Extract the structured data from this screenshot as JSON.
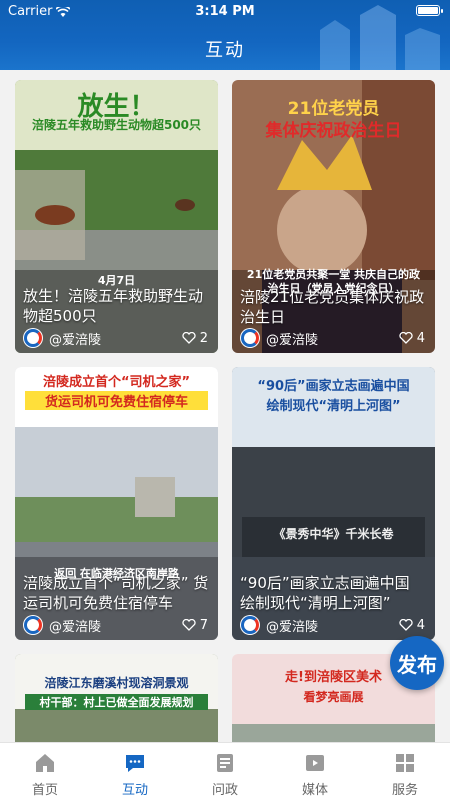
{
  "status": {
    "carrier": "Carrier",
    "time": "3:14 PM"
  },
  "header": {
    "title": "互动"
  },
  "cards": [
    {
      "headline": "放生！",
      "subheadline": "涪陵五年救助野生动物超500只",
      "caption_date": "4月7日",
      "caption": "放生！涪陵五年救助野生动物超500只",
      "author": "@爱涪陵",
      "likes": "2"
    },
    {
      "headline": "21位老党员",
      "subheadline": "集体庆祝政治生日",
      "caption_overlay": "21位老党员共聚一堂 共庆自己的政治生日（党员入党纪念日）",
      "caption": "涪陵21位老党员集体庆祝政治生日",
      "author": "@爱涪陵",
      "likes": "4"
    },
    {
      "headline": "涪陵成立首个“司机之家”",
      "subheadline": "货运司机可免费住宿停车",
      "caption_overlay": "返回 在临港经济区南岸路",
      "caption": "涪陵成立首个“司机之家” 货运司机可免费住宿停车",
      "author": "@爱涪陵",
      "likes": "7"
    },
    {
      "headline": "“90后”画家立志画遍中国",
      "subheadline": "绘制现代“清明上河图”",
      "banner": "《景秀中华》千米长卷",
      "caption": "“90后”画家立志画遍中国 绘制现代“清明上河图”",
      "author": "@爱涪陵",
      "likes": "4"
    },
    {
      "headline": "涪陵江东磨溪村现溶洞景观",
      "subheadline": "村干部：村上已做全面发展规划"
    },
    {
      "headline": "走!到涪陵区美术",
      "subheadline": "看梦亮画展"
    }
  ],
  "fab": {
    "label": "发布"
  },
  "tabs": [
    {
      "label": "首页",
      "icon": "home-icon",
      "active": false
    },
    {
      "label": "互动",
      "icon": "chat-icon",
      "active": true
    },
    {
      "label": "问政",
      "icon": "document-icon",
      "active": false
    },
    {
      "label": "媒体",
      "icon": "video-icon",
      "active": false
    },
    {
      "label": "服务",
      "icon": "grid-icon",
      "active": false
    }
  ],
  "colors": {
    "brand": "#1567c3",
    "header": "#1366c0"
  }
}
